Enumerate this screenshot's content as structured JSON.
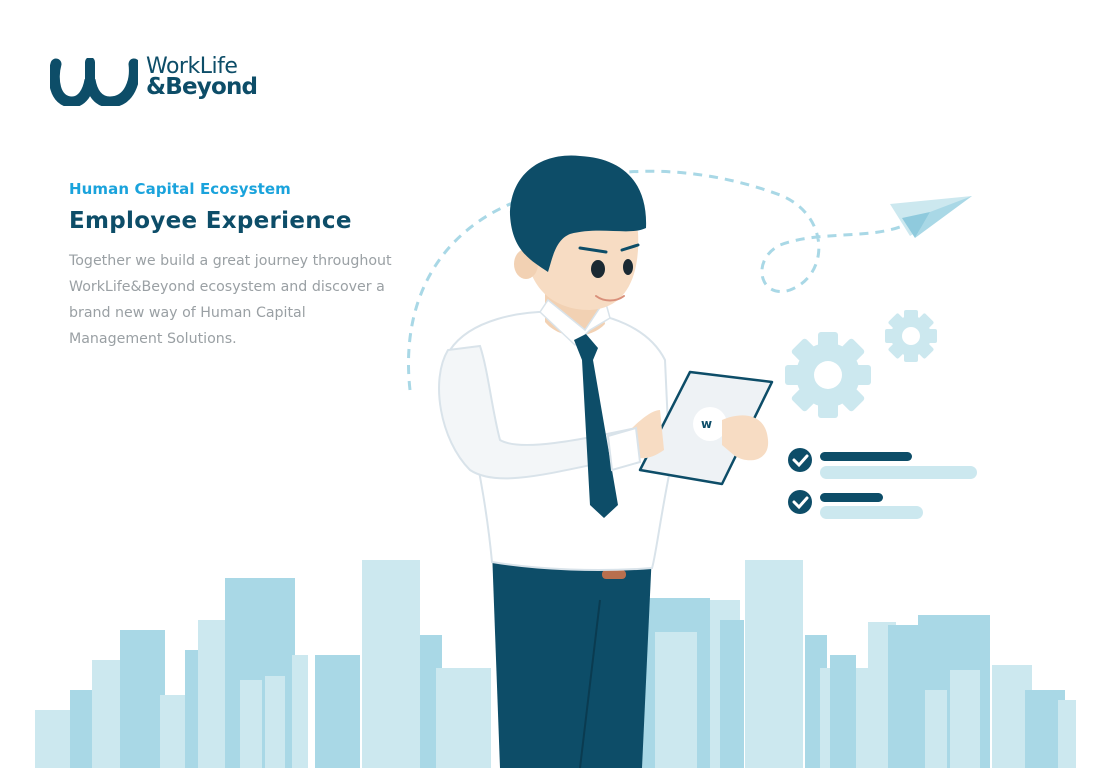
{
  "brand": {
    "name_line1": "WorkLife",
    "name_line2": "&Beyond",
    "mark_name": "worklife-logo-mark",
    "primary_color": "#0d4d68",
    "accent_color": "#1aa3dc"
  },
  "hero": {
    "eyebrow": "Human Capital Ecosystem",
    "title": "Employee Experience",
    "description": "Together we build a great journey throughout WorkLife&Beyond ecosystem and discover a brand new way of Human Capital Management Solutions."
  },
  "illustration": {
    "subject": "businessman-with-tablet",
    "elements": [
      "paper-plane-icon",
      "gear-icon",
      "checklist-icon",
      "city-skyline"
    ]
  }
}
